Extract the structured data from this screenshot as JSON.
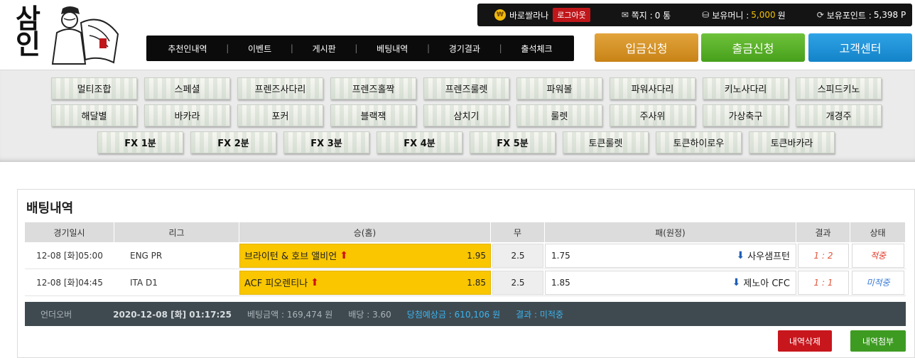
{
  "logo": {
    "text": "삼인"
  },
  "userbar": {
    "username": "바로쌀라나",
    "logout": "로그아웃",
    "messages_label": "쪽지 :",
    "messages_value": "0 통",
    "money_label": "보유머니 :",
    "money_value": "5,000",
    "money_unit": "원",
    "points_label": "보유포인트 :",
    "points_value": "5,398 P"
  },
  "nav": [
    "추천인내역",
    "이벤트",
    "게시판",
    "베팅내역",
    "경기결과",
    "출석체크"
  ],
  "buttons": {
    "deposit": "입금신청",
    "withdraw": "출금신청",
    "support": "고객센터",
    "delete": "내역삭제",
    "attach": "내역첨부"
  },
  "games_row1": [
    "멀티조합",
    "스페셜",
    "프렌즈사다리",
    "프렌즈홀짝",
    "프렌즈룰렛",
    "파워볼",
    "파워사다리",
    "키노사다리",
    "스피드키노"
  ],
  "games_row2": [
    "해달별",
    "바카라",
    "포커",
    "블랙잭",
    "삼치기",
    "룰렛",
    "주사위",
    "가상축구",
    "개경주"
  ],
  "games_row3": [
    "FX 1분",
    "FX 2분",
    "FX 3분",
    "FX 4분",
    "FX 5분",
    "토큰룰렛",
    "토큰하이로우",
    "토큰바카라"
  ],
  "section_title": "배팅내역",
  "table": {
    "headers": [
      "경기일시",
      "리그",
      "승(홈)",
      "무",
      "패(원정)",
      "결과",
      "상태"
    ],
    "rows": [
      {
        "date": "12-08 [화]05:00",
        "league": "ENG PR",
        "home": "브라이턴 & 호브 앨비언",
        "home_odds": "1.95",
        "draw": "2.5",
        "away_odds": "1.75",
        "away": "사우샘프턴",
        "result": "1 : 2",
        "status": "적중"
      },
      {
        "date": "12-08 [화]04:45",
        "league": "ITA D1",
        "home": "ACF 피오렌티나",
        "home_odds": "1.85",
        "draw": "2.5",
        "away_odds": "1.85",
        "away": "제노아 CFC",
        "result": "1 : 1",
        "status": "미적중"
      }
    ]
  },
  "summary": {
    "type": "언더오버",
    "datetime": "2020-12-08 [화] 01:17:25",
    "bet_amount": "베팅금액 : 169,474 원",
    "odds": "배당 : 3.60",
    "expected": "당첨예상금 : 610,106 원",
    "result": "결과 : 미적중"
  },
  "colors": {
    "highlight": "#f9c600",
    "deposit": "#d8962a",
    "withdraw": "#5cb32c",
    "support": "#1f93d8",
    "delete": "#c7161c",
    "attach": "#3e9b22"
  }
}
